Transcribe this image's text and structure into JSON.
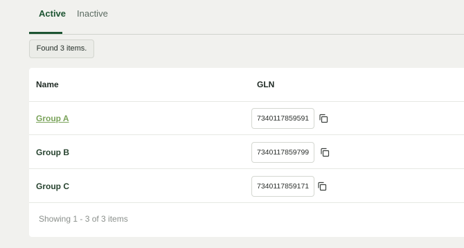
{
  "tabs": [
    {
      "label": "Active",
      "active": true
    },
    {
      "label": "Inactive",
      "active": false
    }
  ],
  "found_label": "Found 3 items.",
  "table": {
    "headers": {
      "name": "Name",
      "gln": "GLN"
    },
    "rows": [
      {
        "name": "Group A",
        "gln": "7340117859591",
        "link": true
      },
      {
        "name": "Group B",
        "gln": "7340117859799",
        "link": false
      },
      {
        "name": "Group C",
        "gln": "7340117859171",
        "link": false
      }
    ]
  },
  "footer": "Showing 1 - 3 of 3 items",
  "icons": {
    "copy": "copy-icon"
  },
  "colors": {
    "accent": "#1d5432",
    "link": "#7aa35a",
    "background": "#f1f1ee"
  }
}
